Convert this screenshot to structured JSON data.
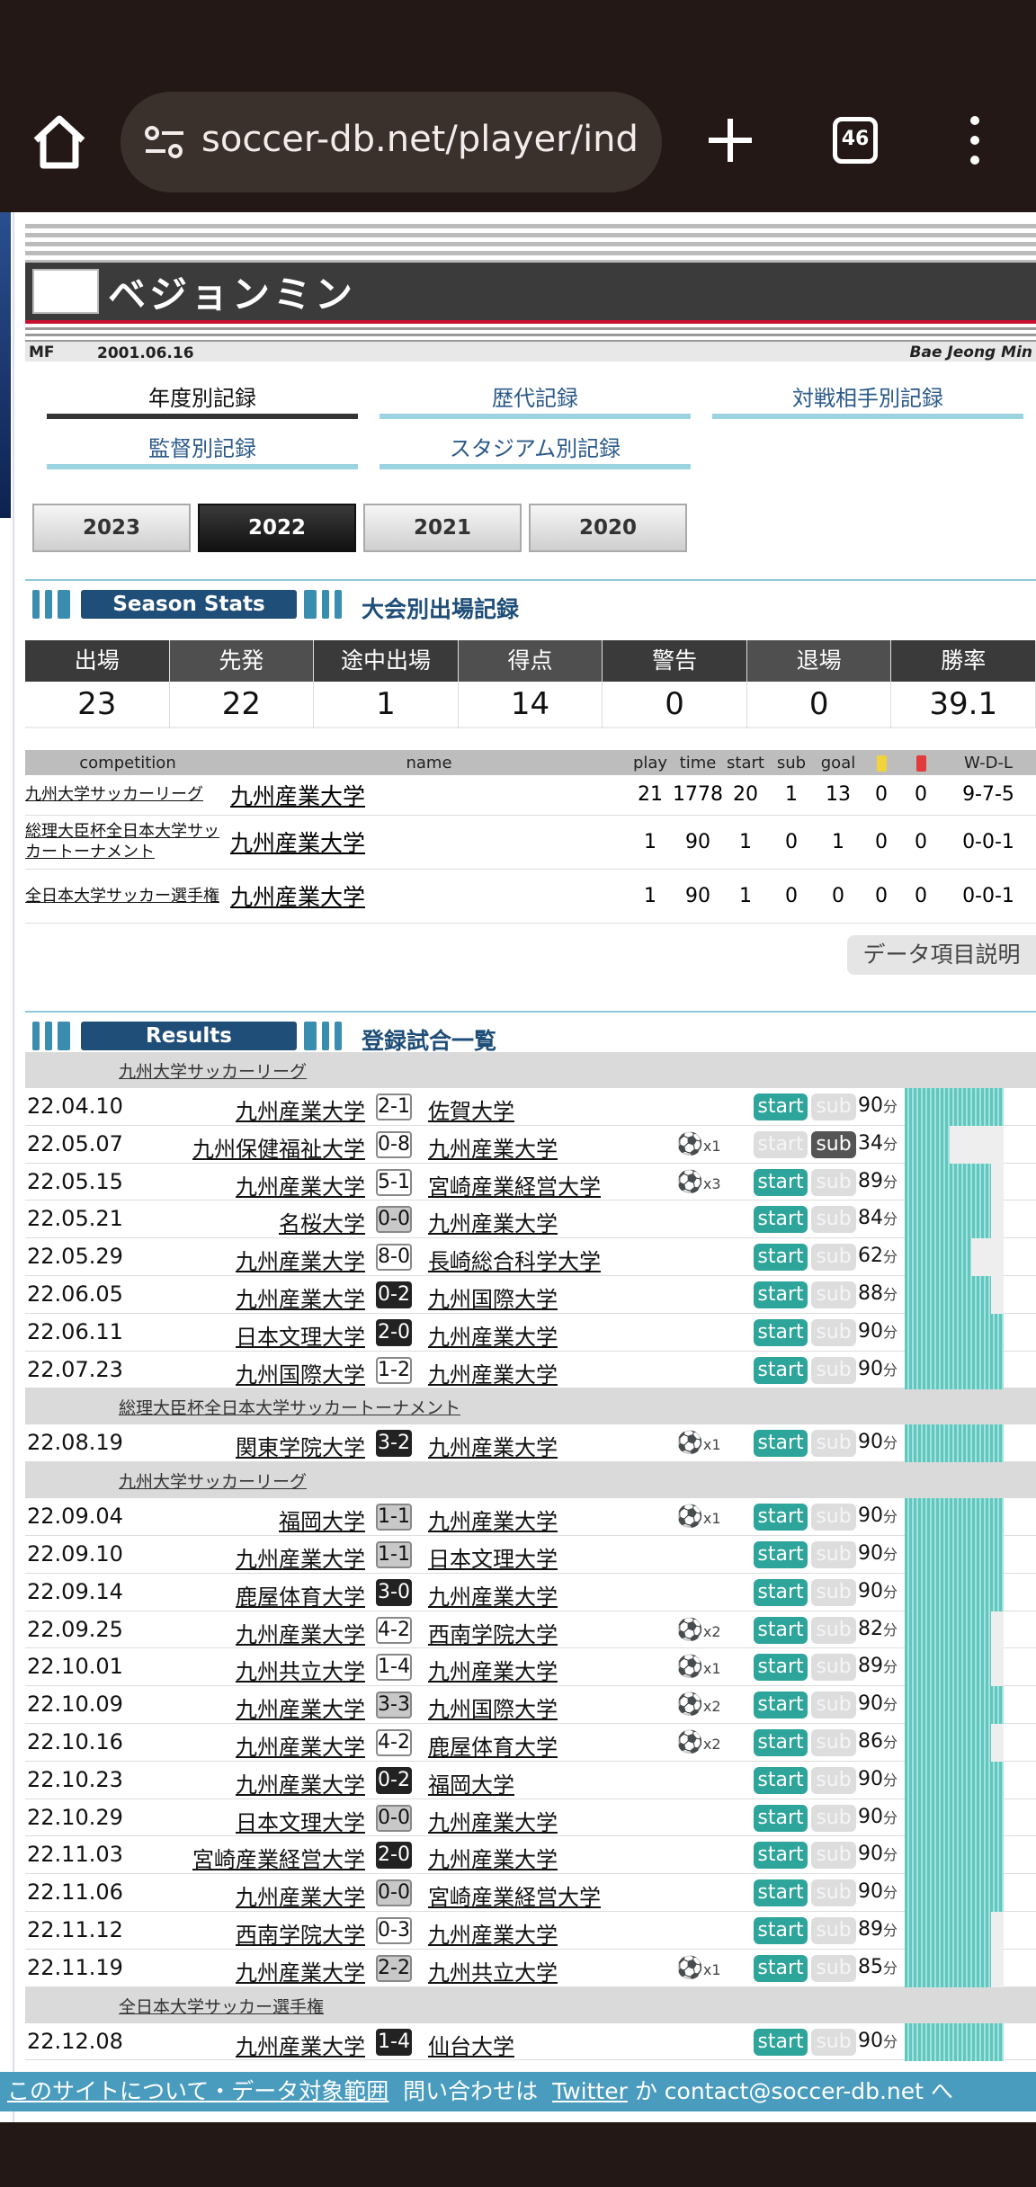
{
  "browser": {
    "url": "soccer-db.net/player/ind",
    "tab_count": "46"
  },
  "player": {
    "name": "ベジョンミン",
    "position": "MF",
    "dob": "2001.06.16",
    "name_en": "Bae Jeong Min"
  },
  "nav": {
    "items": [
      "年度別記録",
      "歴代記録",
      "対戦相手別記録",
      "監督別記録",
      "スタジアム別記録"
    ],
    "active": "年度別記録"
  },
  "years": {
    "items": [
      "2023",
      "2022",
      "2021",
      "2020"
    ],
    "selected": "2022"
  },
  "season": {
    "label": "Season Stats",
    "title": "大会別出場記録",
    "stats": [
      {
        "h": "出場",
        "v": "23",
        "c": "#3a3a3a"
      },
      {
        "h": "先発",
        "v": "22",
        "c": "#4f4f4f"
      },
      {
        "h": "途中出場",
        "v": "1",
        "c": "#3a3a3a"
      },
      {
        "h": "得点",
        "v": "14",
        "c": "#4f4f4f"
      },
      {
        "h": "警告",
        "v": "0",
        "c": "#3a3a3a"
      },
      {
        "h": "退場",
        "v": "0",
        "c": "#4f4f4f"
      },
      {
        "h": "勝率",
        "v": "39.1",
        "c": "#3a3a3a"
      }
    ],
    "table": {
      "headers": [
        "competition",
        "name",
        "play",
        "time",
        "start",
        "sub",
        "goal",
        "",
        "",
        "W-D-L"
      ],
      "rows": [
        [
          "九州大学サッカーリーグ",
          "九州産業大学",
          "21",
          "1778",
          "20",
          "1",
          "13",
          "0",
          "0",
          "9-7-5"
        ],
        [
          "総理大臣杯全日本大学サッカートーナメント",
          "九州産業大学",
          "1",
          "90",
          "1",
          "0",
          "1",
          "0",
          "0",
          "0-0-1"
        ],
        [
          "全日本大学サッカー選手権",
          "九州産業大学",
          "1",
          "90",
          "1",
          "0",
          "0",
          "0",
          "0",
          "0-0-1"
        ]
      ]
    },
    "explain": "データ項目説明"
  },
  "results": {
    "label": "Results",
    "title": "登録試合一覧",
    "blocks": [
      {
        "league": "九州大学サッカーリーグ",
        "rows": [
          [
            "22.04.10",
            "九州産業大学",
            "2-1",
            "佐賀大学",
            "",
            "start",
            "sub",
            "90",
            "w",
            0
          ],
          [
            "22.05.07",
            "九州保健福祉大学",
            "0-8",
            "九州産業大学",
            "x1",
            "start",
            "sub",
            "34",
            "w",
            2
          ],
          [
            "22.05.15",
            "九州産業大学",
            "5-1",
            "宮崎産業経営大学",
            "x3",
            "start",
            "sub",
            "89",
            "w",
            1
          ],
          [
            "22.05.21",
            "名桜大学",
            "0-0",
            "九州産業大学",
            "",
            "start",
            "sub",
            "84",
            "d",
            1
          ],
          [
            "22.05.29",
            "九州産業大学",
            "8-0",
            "長崎総合科学大学",
            "",
            "start",
            "sub",
            "62",
            "w",
            3
          ],
          [
            "22.06.05",
            "九州産業大学",
            "0-2",
            "九州国際大学",
            "",
            "start",
            "sub",
            "88",
            "l",
            1
          ],
          [
            "22.06.11",
            "日本文理大学",
            "2-0",
            "九州産業大学",
            "",
            "start",
            "sub",
            "90",
            "l",
            0
          ],
          [
            "22.07.23",
            "九州国際大学",
            "1-2",
            "九州産業大学",
            "",
            "start",
            "sub",
            "90",
            "w",
            0
          ]
        ]
      },
      {
        "league": "総理大臣杯全日本大学サッカートーナメント",
        "rows": [
          [
            "22.08.19",
            "関東学院大学",
            "3-2",
            "九州産業大学",
            "x1",
            "start",
            "sub",
            "90",
            "l",
            0
          ]
        ]
      },
      {
        "league": "九州大学サッカーリーグ",
        "rows": [
          [
            "22.09.04",
            "福岡大学",
            "1-1",
            "九州産業大学",
            "x1",
            "start",
            "sub",
            "90",
            "d",
            0
          ],
          [
            "22.09.10",
            "九州産業大学",
            "1-1",
            "日本文理大学",
            "",
            "start",
            "sub",
            "90",
            "d",
            0
          ],
          [
            "22.09.14",
            "鹿屋体育大学",
            "3-0",
            "九州産業大学",
            "",
            "start",
            "sub",
            "90",
            "l",
            0
          ],
          [
            "22.09.25",
            "九州産業大学",
            "4-2",
            "西南学院大学",
            "x2",
            "start",
            "sub",
            "82",
            "w",
            1
          ],
          [
            "22.10.01",
            "九州共立大学",
            "1-4",
            "九州産業大学",
            "x1",
            "start",
            "sub",
            "89",
            "w",
            1
          ],
          [
            "22.10.09",
            "九州産業大学",
            "3-3",
            "九州国際大学",
            "x2",
            "start",
            "sub",
            "90",
            "d",
            0
          ],
          [
            "22.10.16",
            "九州産業大学",
            "4-2",
            "鹿屋体育大学",
            "x2",
            "start",
            "sub",
            "86",
            "w",
            1
          ],
          [
            "22.10.23",
            "九州産業大学",
            "0-2",
            "福岡大学",
            "",
            "start",
            "sub",
            "90",
            "l",
            0
          ],
          [
            "22.10.29",
            "日本文理大学",
            "0-0",
            "九州産業大学",
            "",
            "start",
            "sub",
            "90",
            "d",
            0
          ],
          [
            "22.11.03",
            "宮崎産業経営大学",
            "2-0",
            "九州産業大学",
            "",
            "start",
            "sub",
            "90",
            "l",
            0
          ],
          [
            "22.11.06",
            "九州産業大学",
            "0-0",
            "宮崎産業経営大学",
            "",
            "start",
            "sub",
            "90",
            "d",
            0
          ],
          [
            "22.11.12",
            "西南学院大学",
            "0-3",
            "九州産業大学",
            "",
            "start",
            "sub",
            "89",
            "w",
            1
          ],
          [
            "22.11.19",
            "九州産業大学",
            "2-2",
            "九州共立大学",
            "x1",
            "start",
            "sub",
            "85",
            "d",
            1
          ]
        ]
      },
      {
        "league": "全日本大学サッカー選手権",
        "rows": [
          [
            "22.12.08",
            "九州産業大学",
            "1-4",
            "仙台大学",
            "",
            "start",
            "sub",
            "90",
            "l",
            0
          ]
        ]
      }
    ],
    "minute_unit": "分"
  },
  "footer": {
    "about": "このサイトについて・データ対象範囲",
    "contact_prefix": "問い合わせは",
    "twitter": "Twitter",
    "contact_suffix": "か contact@soccer-db.net へ"
  }
}
